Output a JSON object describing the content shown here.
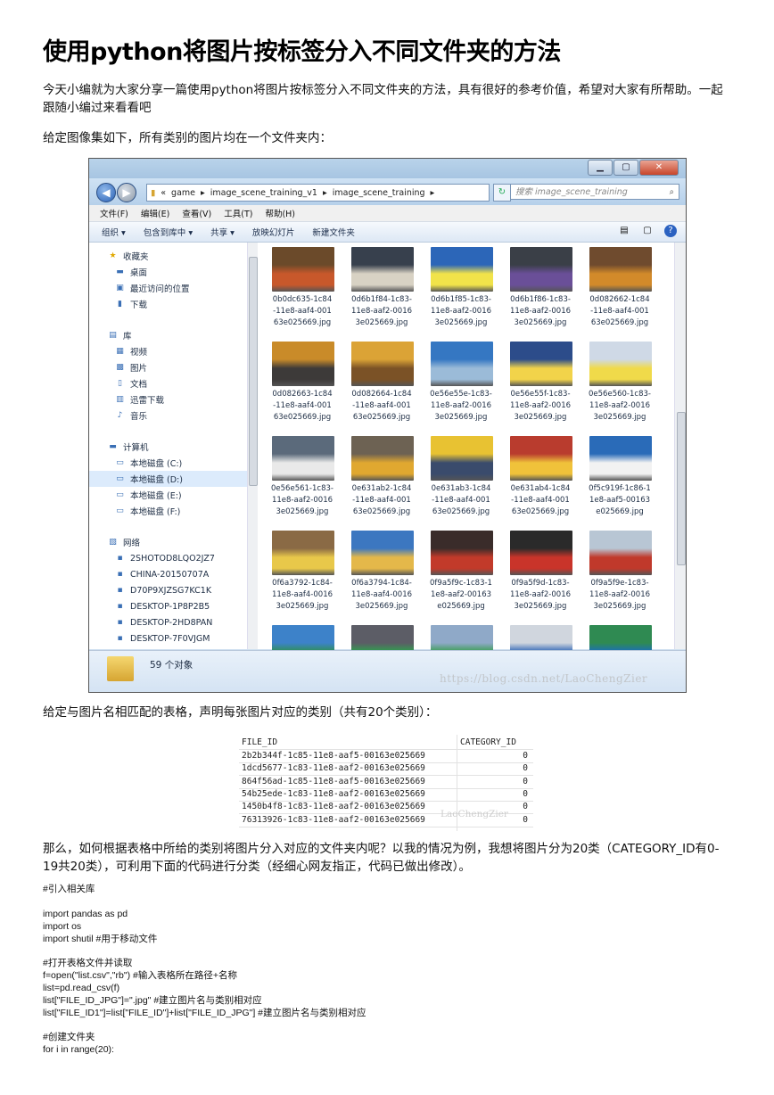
{
  "title": "使用python将图片按标签分入不同文件夹的方法",
  "intro": "今天小编就为大家分享一篇使用python将图片按标签分入不同文件夹的方法，具有很好的参考价值，希望对大家有所帮助。一起跟随小编过来看看吧",
  "para_images": "给定图像集如下，所有类别的图片均在一个文件夹内：",
  "explorer": {
    "address": [
      "«",
      "game",
      "▸",
      "image_scene_training_v1",
      "▸",
      "image_scene_training",
      "▸"
    ],
    "search_placeholder": "搜索 image_scene_training",
    "menu": [
      "文件(F)",
      "编辑(E)",
      "查看(V)",
      "工具(T)",
      "帮助(H)"
    ],
    "toolbar": [
      "组织 ▾",
      "包含到库中 ▾",
      "共享 ▾",
      "放映幻灯片",
      "新建文件夹"
    ],
    "nav": [
      {
        "label": "收藏夹",
        "icon": "★"
      },
      {
        "label": "桌面",
        "icon": "▬"
      },
      {
        "label": "最近访问的位置",
        "icon": "▣"
      },
      {
        "label": "下载",
        "icon": "▮"
      },
      {
        "label": "库",
        "icon": "▤"
      },
      {
        "label": "视频",
        "icon": "▦"
      },
      {
        "label": "图片",
        "icon": "▩"
      },
      {
        "label": "文档",
        "icon": "▯"
      },
      {
        "label": "迅雷下载",
        "icon": "▥"
      },
      {
        "label": "音乐",
        "icon": "♪"
      },
      {
        "label": "计算机",
        "icon": "▬"
      },
      {
        "label": "本地磁盘 (C:)",
        "icon": "▭"
      },
      {
        "label": "本地磁盘 (D:)",
        "icon": "▭"
      },
      {
        "label": "本地磁盘 (E:)",
        "icon": "▭"
      },
      {
        "label": "本地磁盘 (F:)",
        "icon": "▭"
      },
      {
        "label": "网络",
        "icon": "▧"
      },
      {
        "label": "2SHOTOD8LQO2JZ7",
        "icon": "▪"
      },
      {
        "label": "CHINA-20150707A",
        "icon": "▪"
      },
      {
        "label": "D70P9XJZSG7KC1K",
        "icon": "▪"
      },
      {
        "label": "DESKTOP-1P8P2B5",
        "icon": "▪"
      },
      {
        "label": "DESKTOP-2HD8PAN",
        "icon": "▪"
      },
      {
        "label": "DESKTOP-7F0VJGM",
        "icon": "▪"
      }
    ],
    "files": [
      "0b0dc635-1c84-11e8-aaf4-00163e025669.jpg",
      "0d6b1f84-1c83-11e8-aaf2-00163e025669.jpg",
      "0d6b1f85-1c83-11e8-aaf2-00163e025669.jpg",
      "0d6b1f86-1c83-11e8-aaf2-00163e025669.jpg",
      "0d082662-1c84-11e8-aaf4-00163e025669.jpg",
      "0d082663-1c84-11e8-aaf4-00163e025669.jpg",
      "0d082664-1c84-11e8-aaf4-00163e025669.jpg",
      "0e56e55e-1c83-11e8-aaf2-00163e025669.jpg",
      "0e56e55f-1c83-11e8-aaf2-00163e025669.jpg",
      "0e56e560-1c83-11e8-aaf2-00163e025669.jpg",
      "0e56e561-1c83-11e8-aaf2-00163e025669.jpg",
      "0e631ab2-1c84-11e8-aaf4-00163e025669.jpg",
      "0e631ab3-1c84-11e8-aaf4-00163e025669.jpg",
      "0e631ab4-1c84-11e8-aaf4-00163e025669.jpg",
      "0f5c919f-1c86-11e8-aaf5-00163e025669.jpg",
      "0f6a3792-1c84-11e8-aaf4-00163e025669.jpg",
      "0f6a3794-1c84-11e8-aaf4-00163e025669.jpg",
      "0f9a5f9c-1c83-11e8-aaf2-00163e025669.jpg",
      "0f9a5f9d-1c83-11e8-aaf2-00163e025669.jpg",
      "0f9a5f9e-1c83-11e8-aaf2-00163e025669.jpg",
      "",
      "",
      "",
      "",
      ""
    ],
    "file_name_lines": [
      [
        "0b0dc635-1c84",
        "-11e8-aaf4-001",
        "63e025669.jpg"
      ],
      [
        "0d6b1f84-1c83-",
        "11e8-aaf2-0016",
        "3e025669.jpg"
      ],
      [
        "0d6b1f85-1c83-",
        "11e8-aaf2-0016",
        "3e025669.jpg"
      ],
      [
        "0d6b1f86-1c83-",
        "11e8-aaf2-0016",
        "3e025669.jpg"
      ],
      [
        "0d082662-1c84",
        "-11e8-aaf4-001",
        "63e025669.jpg"
      ],
      [
        "0d082663-1c84",
        "-11e8-aaf4-001",
        "63e025669.jpg"
      ],
      [
        "0d082664-1c84",
        "-11e8-aaf4-001",
        "63e025669.jpg"
      ],
      [
        "0e56e55e-1c83-",
        "11e8-aaf2-0016",
        "3e025669.jpg"
      ],
      [
        "0e56e55f-1c83-",
        "11e8-aaf2-0016",
        "3e025669.jpg"
      ],
      [
        "0e56e560-1c83-",
        "11e8-aaf2-0016",
        "3e025669.jpg"
      ],
      [
        "0e56e561-1c83-",
        "11e8-aaf2-0016",
        "3e025669.jpg"
      ],
      [
        "0e631ab2-1c84",
        "-11e8-aaf4-001",
        "63e025669.jpg"
      ],
      [
        "0e631ab3-1c84",
        "-11e8-aaf4-001",
        "63e025669.jpg"
      ],
      [
        "0e631ab4-1c84",
        "-11e8-aaf4-001",
        "63e025669.jpg"
      ],
      [
        "0f5c919f-1c86-1",
        "1e8-aaf5-00163",
        "e025669.jpg"
      ],
      [
        "0f6a3792-1c84-",
        "11e8-aaf4-0016",
        "3e025669.jpg"
      ],
      [
        "0f6a3794-1c84-",
        "11e8-aaf4-0016",
        "3e025669.jpg"
      ],
      [
        "0f9a5f9c-1c83-1",
        "1e8-aaf2-00163",
        "e025669.jpg"
      ],
      [
        "0f9a5f9d-1c83-",
        "11e8-aaf2-0016",
        "3e025669.jpg"
      ],
      [
        "0f9a5f9e-1c83-",
        "11e8-aaf2-0016",
        "3e025669.jpg"
      ],
      [],
      [],
      [],
      [],
      []
    ],
    "thumb_colors": [
      [
        "#6b4a2a",
        "#c8582b"
      ],
      [
        "#37404d",
        "#d8d2c4"
      ],
      [
        "#2c66b8",
        "#f1e34a"
      ],
      [
        "#3a3f47",
        "#6a4f98"
      ],
      [
        "#6f4b2e",
        "#d28a2a"
      ],
      [
        "#c98b29",
        "#3d3a39"
      ],
      [
        "#dba336",
        "#7b5226"
      ],
      [
        "#3577c2",
        "#9bbbd8"
      ],
      [
        "#2c4c8a",
        "#f2d34a"
      ],
      [
        "#cfd9e6",
        "#f0da4a"
      ],
      [
        "#5b6a7b",
        "#e9e9e9"
      ],
      [
        "#6d6253",
        "#e0a830"
      ],
      [
        "#e8c232",
        "#3a4b6c"
      ],
      [
        "#b93c2e",
        "#f0c23a"
      ],
      [
        "#2a6bb8",
        "#f2f2f2"
      ],
      [
        "#8a6a45",
        "#e8c84a"
      ],
      [
        "#3c77c0",
        "#e4b84a"
      ],
      [
        "#3a2c2a",
        "#c23a2a"
      ],
      [
        "#2a2a2a",
        "#c9342a"
      ],
      [
        "#b8c6d4",
        "#c0392b"
      ],
      [
        "#3d82c9",
        "#2f8f52"
      ],
      [
        "#5c5d66",
        "#2fa04e"
      ],
      [
        "#8fa9c8",
        "#3a9e52"
      ],
      [
        "#d0d6de",
        "#2f66b6"
      ],
      [
        "#2f8a52",
        "#1a6fba"
      ]
    ],
    "status": "59 个对象",
    "watermark": "https://blog.csdn.net/LaoChengZier"
  },
  "para_table": "给定与图片名相匹配的表格，声明每张图片对应的类别（共有20个类别）：",
  "csv_table": {
    "headers": [
      "FILE_ID",
      "CATEGORY_ID"
    ],
    "rows": [
      [
        "2b2b344f-1c85-11e8-aaf5-00163e025669",
        "0"
      ],
      [
        "1dcd5677-1c83-11e8-aaf2-00163e025669",
        "0"
      ],
      [
        "864f56ad-1c85-11e8-aaf5-00163e025669",
        "0"
      ],
      [
        "54b25ede-1c83-11e8-aaf2-00163e025669",
        "0"
      ],
      [
        "1450b4f8-1c83-11e8-aaf2-00163e025669",
        "0"
      ],
      [
        "76313926-1c83-11e8-aaf2-00163e025669",
        "0"
      ]
    ],
    "watermark": "LaoChengZier"
  },
  "para_method": "那么，如何根据表格中所给的类别将图片分入对应的文件夹内呢？以我的情况为例，我想将图片分为20类（CATEGORY_ID有0-19共20类），可利用下面的代码进行分类（经细心网友指正，代码已做出修改）。",
  "code": {
    "c1": "#引入相关库",
    "l1": "import pandas as pd",
    "l2": "import os",
    "l3": "import shutil #用于移动文件",
    "c2": "#打开表格文件并读取",
    "l4": "f=open(\"list.csv\",\"rb\") #输入表格所在路径+名称",
    "l5": "list=pd.read_csv(f)",
    "l6": "list[\"FILE_ID_JPG\"]=\".jpg\" #建立图片名与类别相对应",
    "l7": "list[\"FILE_ID1\"]=list[\"FILE_ID\"]+list[\"FILE_ID_JPG\"] #建立图片名与类别相对应",
    "c3": "#创建文件夹",
    "l8": "for i in range(20):"
  }
}
